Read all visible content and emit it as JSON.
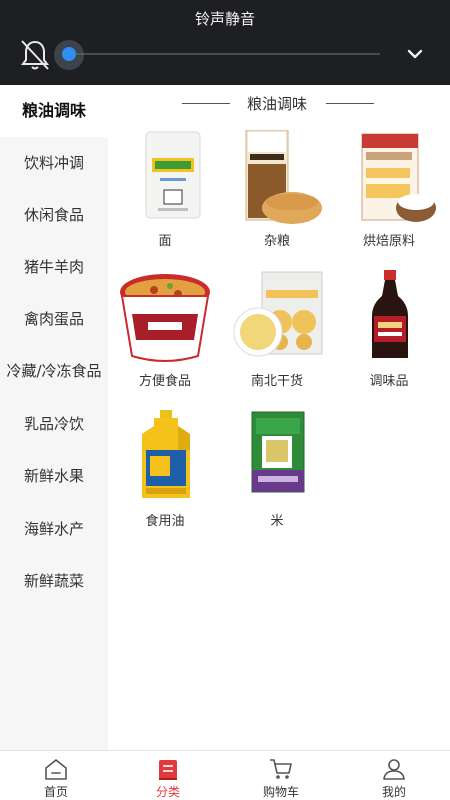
{
  "volume_overlay": {
    "title": "铃声静音",
    "level": 0.0,
    "accent_color": "#2f8ef2"
  },
  "sidebar": {
    "items": [
      {
        "label": "粮油调味",
        "active": true
      },
      {
        "label": "饮料冲调",
        "active": false
      },
      {
        "label": "休闲食品",
        "active": false
      },
      {
        "label": "猪牛羊肉",
        "active": false
      },
      {
        "label": "禽肉蛋品",
        "active": false
      },
      {
        "label": "冷藏/冷冻食品",
        "active": false
      },
      {
        "label": "乳品冷饮",
        "active": false
      },
      {
        "label": "新鲜水果",
        "active": false
      },
      {
        "label": "海鲜水产",
        "active": false
      },
      {
        "label": "新鲜蔬菜",
        "active": false
      }
    ]
  },
  "main": {
    "section_title": "粮油调味",
    "products": [
      {
        "label": "面",
        "icon": "flour-bag-icon"
      },
      {
        "label": "杂粮",
        "icon": "grain-bag-icon"
      },
      {
        "label": "烘焙原料",
        "icon": "baking-mix-icon"
      },
      {
        "label": "方便食品",
        "icon": "instant-noodle-cup-icon"
      },
      {
        "label": "南北干货",
        "icon": "dried-goods-icon"
      },
      {
        "label": "调味品",
        "icon": "soy-sauce-bottle-icon"
      },
      {
        "label": "食用油",
        "icon": "oil-bottle-icon"
      },
      {
        "label": "米",
        "icon": "rice-bag-icon"
      }
    ]
  },
  "bottom_nav": {
    "items": [
      {
        "label": "首页",
        "icon": "home-icon",
        "active": false
      },
      {
        "label": "分类",
        "icon": "category-icon",
        "active": true
      },
      {
        "label": "购物车",
        "icon": "cart-icon",
        "active": false
      },
      {
        "label": "我的",
        "icon": "user-icon",
        "active": false
      }
    ],
    "active_color": "#e4393c"
  }
}
